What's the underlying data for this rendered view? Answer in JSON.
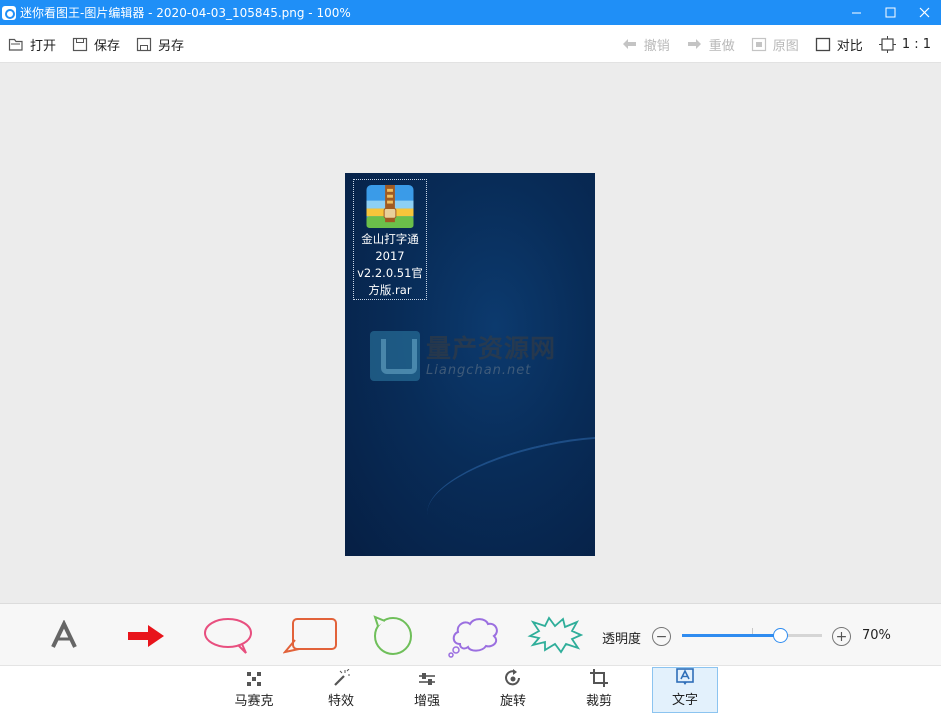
{
  "window": {
    "title": "迷你看图王-图片编辑器 - 2020-04-03_105845.png - 100%",
    "minimize": "—",
    "maximize": "☐",
    "close": "✕"
  },
  "toolbar": {
    "open_label": "打开",
    "save_label": "保存",
    "saveas_label": "另存",
    "undo_label": "撤销",
    "redo_label": "重做",
    "original_label": "原图",
    "compare_label": "对比",
    "ratio_label": "1 : 1"
  },
  "image": {
    "icon_label_lines": [
      "金山打字通",
      "2017",
      "v2.2.0.51官",
      "方版.rar"
    ],
    "watermark_cn": "量产资源网",
    "watermark_en": "Liangchan.net"
  },
  "draw_options": {
    "shapes": [
      "text-a",
      "arrow",
      "oval-bubble",
      "rect-bubble",
      "circle-bubble",
      "cloud-bubble",
      "burst-bubble"
    ],
    "opacity_label": "透明度",
    "opacity_value": "70%",
    "opacity_fraction": 0.7
  },
  "tools": {
    "mosaic_label": "马赛克",
    "effects_label": "特效",
    "enhance_label": "增强",
    "rotate_label": "旋转",
    "crop_label": "裁剪",
    "text_label": "文字",
    "active": "text"
  },
  "colors": {
    "titlebar": "#1f8ff7",
    "accent": "#2f8cf0",
    "arrow": "#e8141b",
    "oval": "#e84f7f",
    "rect": "#e2623a",
    "circle": "#6fbf5a",
    "cloud": "#9b6fe0",
    "burst": "#2fae9a"
  }
}
